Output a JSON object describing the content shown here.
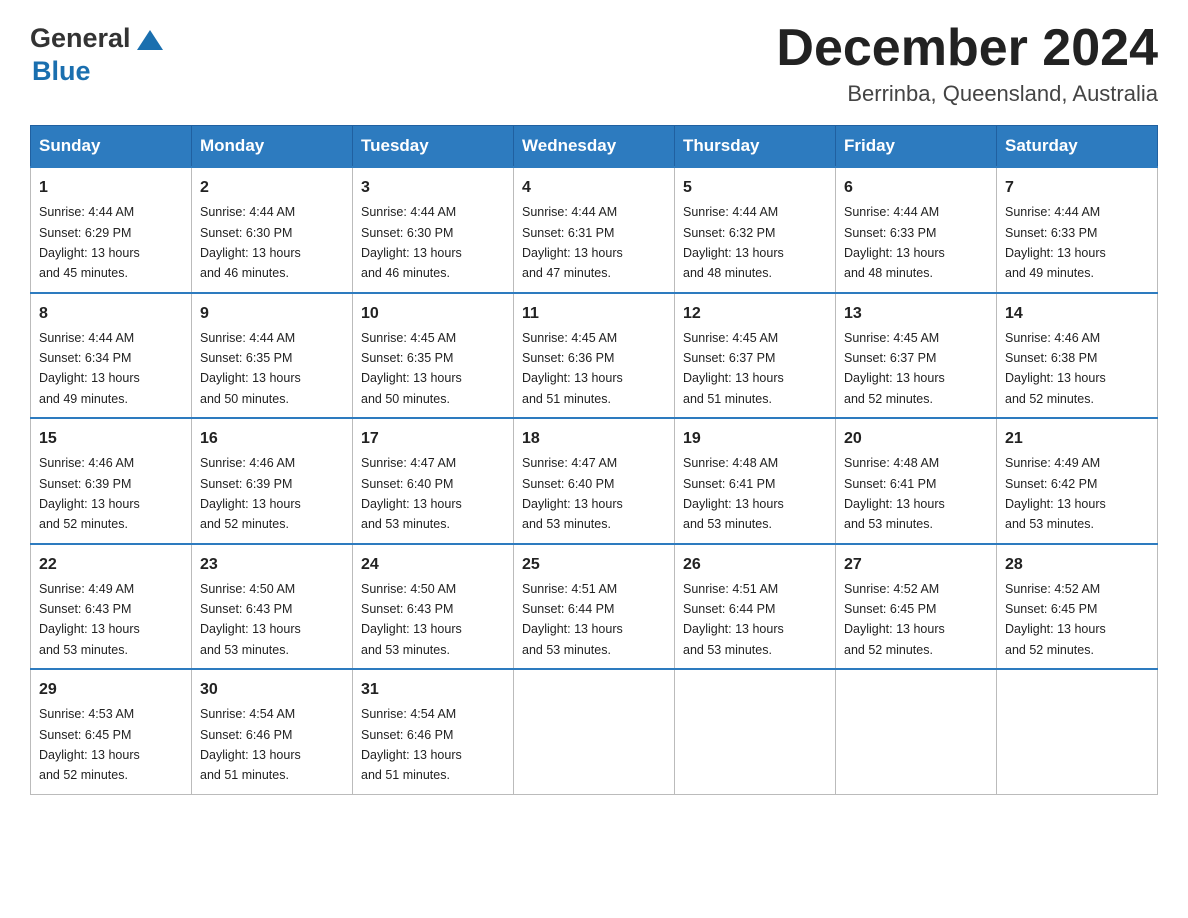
{
  "header": {
    "logo_general": "General",
    "logo_blue": "Blue",
    "month_title": "December 2024",
    "location": "Berrinba, Queensland, Australia"
  },
  "weekdays": [
    "Sunday",
    "Monday",
    "Tuesday",
    "Wednesday",
    "Thursday",
    "Friday",
    "Saturday"
  ],
  "weeks": [
    [
      {
        "day": "1",
        "sunrise": "4:44 AM",
        "sunset": "6:29 PM",
        "daylight": "13 hours and 45 minutes."
      },
      {
        "day": "2",
        "sunrise": "4:44 AM",
        "sunset": "6:30 PM",
        "daylight": "13 hours and 46 minutes."
      },
      {
        "day": "3",
        "sunrise": "4:44 AM",
        "sunset": "6:30 PM",
        "daylight": "13 hours and 46 minutes."
      },
      {
        "day": "4",
        "sunrise": "4:44 AM",
        "sunset": "6:31 PM",
        "daylight": "13 hours and 47 minutes."
      },
      {
        "day": "5",
        "sunrise": "4:44 AM",
        "sunset": "6:32 PM",
        "daylight": "13 hours and 48 minutes."
      },
      {
        "day": "6",
        "sunrise": "4:44 AM",
        "sunset": "6:33 PM",
        "daylight": "13 hours and 48 minutes."
      },
      {
        "day": "7",
        "sunrise": "4:44 AM",
        "sunset": "6:33 PM",
        "daylight": "13 hours and 49 minutes."
      }
    ],
    [
      {
        "day": "8",
        "sunrise": "4:44 AM",
        "sunset": "6:34 PM",
        "daylight": "13 hours and 49 minutes."
      },
      {
        "day": "9",
        "sunrise": "4:44 AM",
        "sunset": "6:35 PM",
        "daylight": "13 hours and 50 minutes."
      },
      {
        "day": "10",
        "sunrise": "4:45 AM",
        "sunset": "6:35 PM",
        "daylight": "13 hours and 50 minutes."
      },
      {
        "day": "11",
        "sunrise": "4:45 AM",
        "sunset": "6:36 PM",
        "daylight": "13 hours and 51 minutes."
      },
      {
        "day": "12",
        "sunrise": "4:45 AM",
        "sunset": "6:37 PM",
        "daylight": "13 hours and 51 minutes."
      },
      {
        "day": "13",
        "sunrise": "4:45 AM",
        "sunset": "6:37 PM",
        "daylight": "13 hours and 52 minutes."
      },
      {
        "day": "14",
        "sunrise": "4:46 AM",
        "sunset": "6:38 PM",
        "daylight": "13 hours and 52 minutes."
      }
    ],
    [
      {
        "day": "15",
        "sunrise": "4:46 AM",
        "sunset": "6:39 PM",
        "daylight": "13 hours and 52 minutes."
      },
      {
        "day": "16",
        "sunrise": "4:46 AM",
        "sunset": "6:39 PM",
        "daylight": "13 hours and 52 minutes."
      },
      {
        "day": "17",
        "sunrise": "4:47 AM",
        "sunset": "6:40 PM",
        "daylight": "13 hours and 53 minutes."
      },
      {
        "day": "18",
        "sunrise": "4:47 AM",
        "sunset": "6:40 PM",
        "daylight": "13 hours and 53 minutes."
      },
      {
        "day": "19",
        "sunrise": "4:48 AM",
        "sunset": "6:41 PM",
        "daylight": "13 hours and 53 minutes."
      },
      {
        "day": "20",
        "sunrise": "4:48 AM",
        "sunset": "6:41 PM",
        "daylight": "13 hours and 53 minutes."
      },
      {
        "day": "21",
        "sunrise": "4:49 AM",
        "sunset": "6:42 PM",
        "daylight": "13 hours and 53 minutes."
      }
    ],
    [
      {
        "day": "22",
        "sunrise": "4:49 AM",
        "sunset": "6:43 PM",
        "daylight": "13 hours and 53 minutes."
      },
      {
        "day": "23",
        "sunrise": "4:50 AM",
        "sunset": "6:43 PM",
        "daylight": "13 hours and 53 minutes."
      },
      {
        "day": "24",
        "sunrise": "4:50 AM",
        "sunset": "6:43 PM",
        "daylight": "13 hours and 53 minutes."
      },
      {
        "day": "25",
        "sunrise": "4:51 AM",
        "sunset": "6:44 PM",
        "daylight": "13 hours and 53 minutes."
      },
      {
        "day": "26",
        "sunrise": "4:51 AM",
        "sunset": "6:44 PM",
        "daylight": "13 hours and 53 minutes."
      },
      {
        "day": "27",
        "sunrise": "4:52 AM",
        "sunset": "6:45 PM",
        "daylight": "13 hours and 52 minutes."
      },
      {
        "day": "28",
        "sunrise": "4:52 AM",
        "sunset": "6:45 PM",
        "daylight": "13 hours and 52 minutes."
      }
    ],
    [
      {
        "day": "29",
        "sunrise": "4:53 AM",
        "sunset": "6:45 PM",
        "daylight": "13 hours and 52 minutes."
      },
      {
        "day": "30",
        "sunrise": "4:54 AM",
        "sunset": "6:46 PM",
        "daylight": "13 hours and 51 minutes."
      },
      {
        "day": "31",
        "sunrise": "4:54 AM",
        "sunset": "6:46 PM",
        "daylight": "13 hours and 51 minutes."
      },
      null,
      null,
      null,
      null
    ]
  ],
  "labels": {
    "sunrise": "Sunrise:",
    "sunset": "Sunset:",
    "daylight": "Daylight:"
  }
}
